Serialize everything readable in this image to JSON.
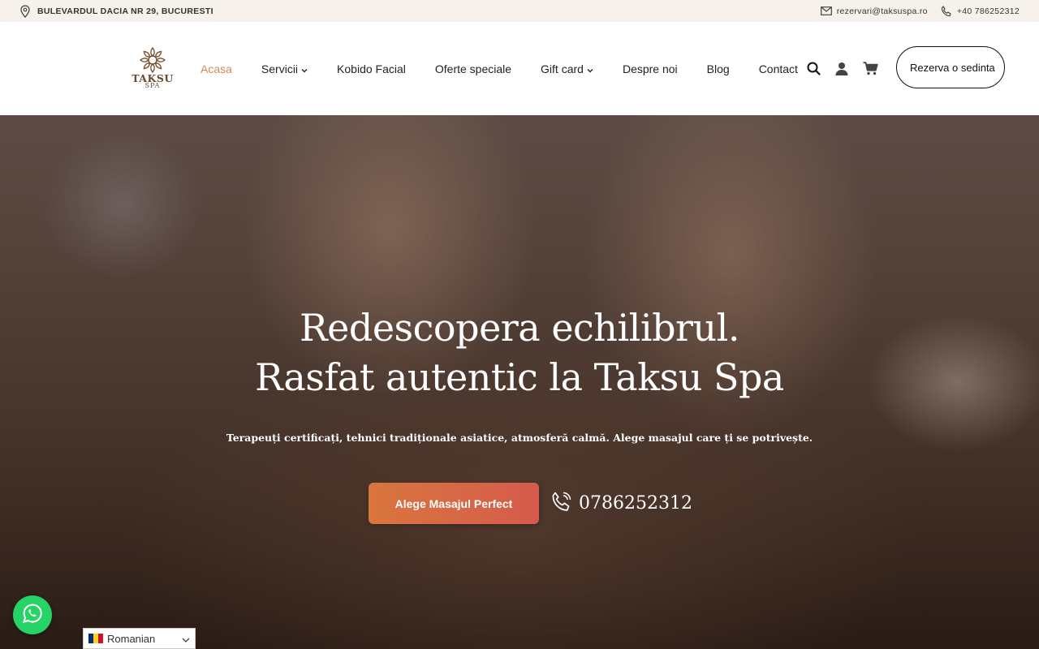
{
  "topbar": {
    "address": "BULEVARDUL DACIA NR 29, BUCURESTI",
    "email": "rezervari@taksuspa.ro",
    "phone": "+40 786252312",
    "icons": {
      "address": "location-pin-icon",
      "email": "envelope-icon",
      "phone": "phone-icon"
    }
  },
  "logo": {
    "brand": "TAKSU",
    "sub": "SPA",
    "icon": "mandala-flower-icon"
  },
  "nav": {
    "items": [
      {
        "label": "Acasa",
        "active": true,
        "dropdown": false
      },
      {
        "label": "Servicii",
        "active": false,
        "dropdown": true
      },
      {
        "label": "Kobido Facial",
        "active": false,
        "dropdown": false
      },
      {
        "label": "Oferte speciale",
        "active": false,
        "dropdown": false
      },
      {
        "label": "Gift card",
        "active": false,
        "dropdown": true
      },
      {
        "label": "Despre noi",
        "active": false,
        "dropdown": false
      },
      {
        "label": "Blog",
        "active": false,
        "dropdown": false
      },
      {
        "label": "Contact",
        "active": false,
        "dropdown": false
      }
    ],
    "icons": [
      "search-icon",
      "user-icon",
      "cart-icon"
    ],
    "book_button": "Rezerva o sedinta"
  },
  "hero": {
    "title_line1": "Redescopera echilibrul.",
    "title_line2": "Rasfat autentic la Taksu Spa",
    "tagline": "Terapeuți certificați, tehnici tradiționale asiatice, atmosferă calmă. Alege masajul care ți se potrivește.",
    "cta": "Alege Masajul Perfect",
    "phone": "0786252312"
  },
  "widgets": {
    "whatsapp_icon": "whatsapp-icon",
    "language": "Romanian"
  },
  "colors": {
    "accent": "#d4895a",
    "cta_start": "#d9763e",
    "cta_end": "#d55a4c",
    "topbar_bg": "#f7f1ec",
    "whatsapp": "#25d366"
  }
}
